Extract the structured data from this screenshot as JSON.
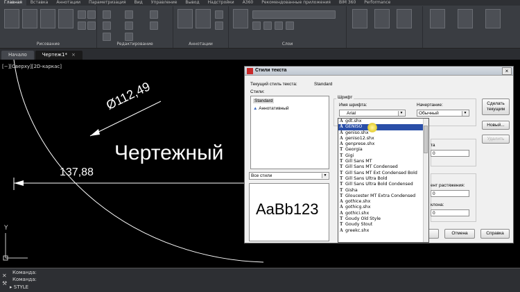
{
  "ribbon": {
    "tabs": [
      "Главная",
      "Вставка",
      "Аннотации",
      "Параметризация",
      "Вид",
      "Управление",
      "Вывод",
      "Надстройки",
      "A360",
      "Рекомендованные приложения",
      "BIM 360",
      "Performance"
    ],
    "panels": {
      "draw": "Рисование",
      "modify": "Редактирование",
      "annotations": "Аннотации",
      "layers": "Слои"
    }
  },
  "file_tabs": [
    {
      "label": "Начало",
      "active": false
    },
    {
      "label": "Чертеж1*",
      "active": true,
      "close": "×"
    }
  ],
  "view_label": "[−][Сверху][2D-каркас]",
  "drawing": {
    "dimension_diameter": "Ø112,49",
    "dimension_linear": "137,88",
    "text_sample": "Чертежный",
    "axis_y": "Y"
  },
  "command_line": {
    "line1": "Команда:",
    "line2": "Команда:",
    "line3": "STYLE"
  },
  "dialog": {
    "title": "Стили текста",
    "close": "×",
    "current_style_label": "Текущий стиль текста:",
    "current_style_value": "Standard",
    "styles_label": "Стили:",
    "styles": [
      {
        "name": "Standard",
        "selected": true
      },
      {
        "name": "Аннотативный",
        "selected": false
      }
    ],
    "filter_value": "Все стили",
    "preview_text": "AaBb123",
    "font_group_label": "Шрифт",
    "font_name_label": "Имя шрифта:",
    "font_name_value": "Arial",
    "style_label": "Начертание:",
    "style_value": "Обычный",
    "buttons": {
      "set_current": "Сделать текущим",
      "new": "Новый...",
      "delete": "Удалить",
      "cancel": "Отмена",
      "help": "Справка"
    },
    "partial_labels": {
      "size": "та",
      "size_value": "0",
      "width_factor": "ент растяжения:",
      "width_value": "0",
      "oblique": "клона:",
      "oblique_value": "0"
    },
    "font_list": [
      {
        "name": "gdt.shx",
        "icon": "A"
      },
      {
        "name": "GENISO",
        "icon": "A",
        "selected": true
      },
      {
        "name": "geniso.shx",
        "icon": "A"
      },
      {
        "name": "geniso12.shx",
        "icon": "A"
      },
      {
        "name": "genprese.shx",
        "icon": "A"
      },
      {
        "name": "Georgia",
        "icon": "T"
      },
      {
        "name": "Gigi",
        "icon": "T"
      },
      {
        "name": "Gill Sans MT",
        "icon": "T"
      },
      {
        "name": "Gill Sans MT Condensed",
        "icon": "T"
      },
      {
        "name": "Gill Sans MT Ext Condensed Bold",
        "icon": "T"
      },
      {
        "name": "Gill Sans Ultra Bold",
        "icon": "T"
      },
      {
        "name": "Gill Sans Ultra Bold Condensed",
        "icon": "T"
      },
      {
        "name": "Gisha",
        "icon": "T"
      },
      {
        "name": "Gloucester MT Extra Condensed",
        "icon": "T"
      },
      {
        "name": "gothice.shx",
        "icon": "A"
      },
      {
        "name": "gothicg.shx",
        "icon": "A"
      },
      {
        "name": "gothici.shx",
        "icon": "A"
      },
      {
        "name": "Goudy Old Style",
        "icon": "T"
      },
      {
        "name": "Goudy Stout",
        "icon": "T"
      },
      {
        "name": "greekc.shx",
        "icon": "A"
      }
    ]
  }
}
